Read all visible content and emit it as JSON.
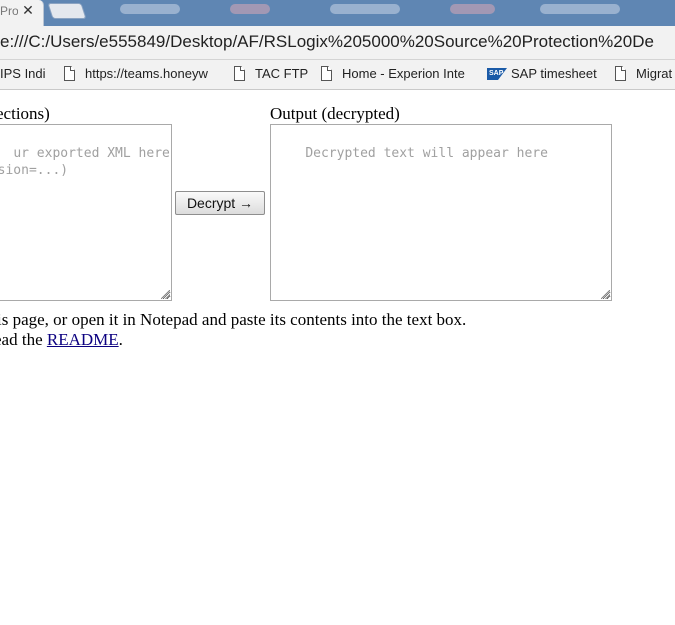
{
  "browser": {
    "tab": {
      "title": "Prot",
      "close_glyph": "✕"
    },
    "url": "e:///C:/Users/e555849/Desktop/AF/RSLogix%205000%20Source%20Protection%20De",
    "bookmarks": [
      {
        "label": "IPS Indi",
        "icon": "none"
      },
      {
        "label": "https://teams.honeyw",
        "icon": "page-icon"
      },
      {
        "label": "TAC FTP",
        "icon": "page-icon"
      },
      {
        "label": "Home - Experion Inte",
        "icon": "page-icon"
      },
      {
        "label": "SAP timesheet",
        "icon": "sap-logo-icon"
      },
      {
        "label": "Migrat",
        "icon": "page-icon"
      }
    ]
  },
  "page": {
    "input": {
      "label": "ections)",
      "placeholder": "ur exported XML here\nersion=...)"
    },
    "decrypt_button": "Decrypt →",
    "output": {
      "label": "Output (decrypted)",
      "placeholder": "Decrypted text will appear here"
    },
    "instructions": "is page, or open it in Notepad and paste its contents into the text box.",
    "readme": {
      "prefix": "ead the ",
      "link": "README",
      "suffix": "."
    }
  },
  "colors": {
    "tabstrip": "#5f86b3",
    "chrome": "#f2f2f2",
    "link": "#0b0080"
  }
}
